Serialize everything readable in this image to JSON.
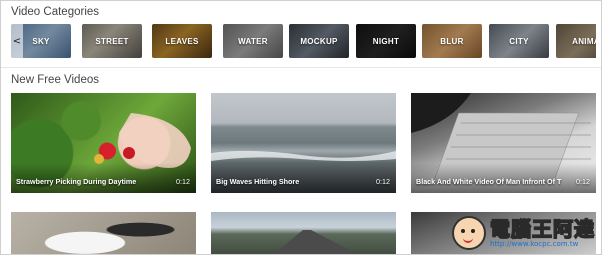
{
  "categories_section": {
    "title": "Video Categories",
    "prev_arrow": "<",
    "items": [
      {
        "label": "SKY"
      },
      {
        "label": "STREET"
      },
      {
        "label": "LEAVES"
      },
      {
        "label": "WATER"
      },
      {
        "label": "MOCKUP"
      },
      {
        "label": "NIGHT"
      },
      {
        "label": "BLUR"
      },
      {
        "label": "CITY"
      },
      {
        "label": "ANIMA"
      }
    ]
  },
  "videos_section": {
    "title": "New Free Videos",
    "videos": [
      {
        "title": "Strawberry Picking During Daytime",
        "duration": "0:12"
      },
      {
        "title": "Big Waves Hitting Shore",
        "duration": "0:12"
      },
      {
        "title": "Black And White Video Of Man Infront Of T",
        "duration": "0:12"
      }
    ]
  },
  "watermark": {
    "text": "電腦王阿達",
    "url": "http://www.kocpc.com.tw"
  },
  "colors": {
    "background": "#ffffff",
    "title_text": "#444444",
    "watermark_url": "#1e6fd0"
  }
}
